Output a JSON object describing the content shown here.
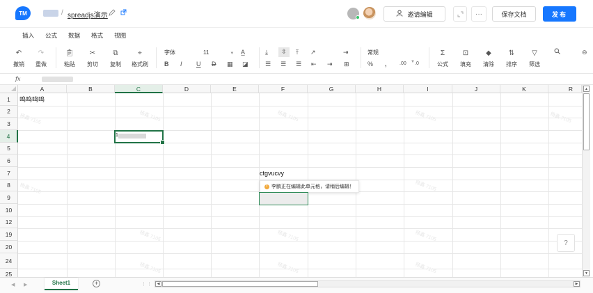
{
  "header": {
    "logo_text": "TM",
    "doc_title": "spreadjs演示",
    "invite_label": "邀请编辑",
    "more_label": "···",
    "save_label": "保存文档",
    "publish_label": "发布",
    "breadcrumb_sep": "/"
  },
  "menu": [
    "插入",
    "公式",
    "数据",
    "格式",
    "视图"
  ],
  "toolbar": {
    "undo": "撤销",
    "redo": "重做",
    "paste": "粘贴",
    "cut": "剪切",
    "copy": "复制",
    "format_painter": "格式刷",
    "font_family": "字体",
    "font_size": "11",
    "number_format": "常规",
    "percent": "%",
    "comma": ",",
    "formula": "公式",
    "fill": "填充",
    "clear": "清除",
    "sort": "排序",
    "filter": "筛选",
    "bold": "B",
    "italic": "I",
    "underline": "U",
    "strike": "D"
  },
  "formula_bar": {
    "fx_label": "fx"
  },
  "grid": {
    "columns": [
      "A",
      "B",
      "C",
      "D",
      "E",
      "F",
      "G",
      "H",
      "I",
      "J",
      "K",
      "R"
    ],
    "rows": [
      "1",
      "2",
      "3",
      "4",
      "5",
      "6",
      "7",
      "8",
      "9",
      "10",
      "12",
      "19",
      "20",
      "24",
      "25"
    ],
    "selected_column": "C",
    "selected_row": "4",
    "cell_a1": "呜呜呜呜",
    "cell_c4_prefix": "1",
    "other_user_name": "ctgvucvy",
    "tooltip": "李鹏正在编辑此单元格，请稍后编辑！",
    "warn_glyph": "!",
    "watermark": "杨鑫 7105",
    "help_glyph": "?"
  },
  "sheets": {
    "active": "Sheet1",
    "add_glyph": "+",
    "nav_left": "◀",
    "nav_right": "▶",
    "dots": "⋮⋮"
  },
  "colors": {
    "accent": "#1677ff",
    "sheet_green": "#217346",
    "warn": "#f2a93b"
  }
}
